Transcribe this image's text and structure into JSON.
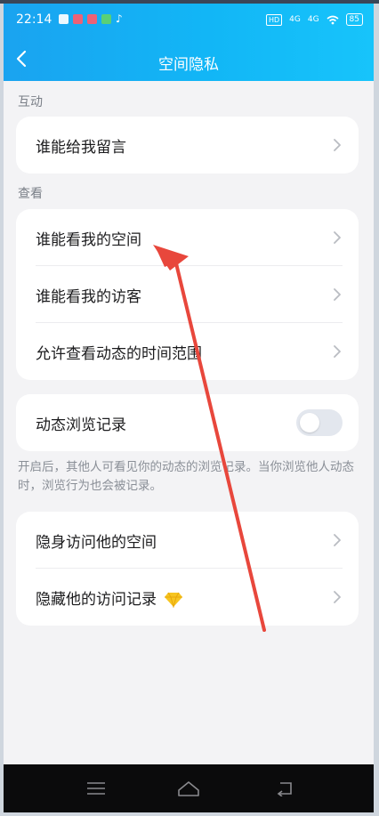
{
  "statusbar": {
    "time": "22:14",
    "network_1": "4G",
    "network_2": "4G",
    "battery": "85",
    "hd_badge": "HD"
  },
  "header": {
    "title": "空间隐私"
  },
  "sections": {
    "interaction": {
      "label": "互动",
      "items": [
        "谁能给我留言"
      ]
    },
    "view": {
      "label": "查看",
      "items": [
        "谁能看我的空间",
        "谁能看我的访客",
        "允许查看动态的时间范围"
      ]
    }
  },
  "browse_record": {
    "label": "动态浏览记录",
    "toggle_on": false,
    "description": "开启后，其他人可看见你的动态的浏览记录。当你浏览他人动态时，浏览行为也会被记录。"
  },
  "stealth": {
    "items": [
      "隐身访问他的空间",
      "隐藏他的访问记录"
    ],
    "badge_icon": "diamond-icon"
  },
  "navbar": {
    "icons": [
      "menu-icon",
      "home-icon",
      "back-nav-icon"
    ]
  },
  "annotation": {
    "color": "#e8473c"
  }
}
